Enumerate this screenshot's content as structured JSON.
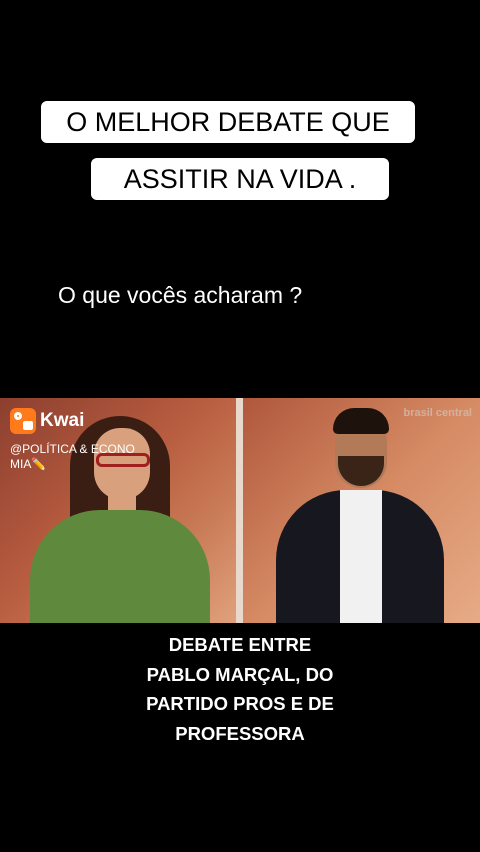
{
  "title": {
    "line1": "O MELHOR DEBATE QUE",
    "line2": "ASSITIR NA VIDA ."
  },
  "question": "O que vocês acharam ?",
  "video": {
    "watermark": {
      "brand": "Kwai",
      "handle_line1": "@POLÍTICA & ECONO",
      "handle_line2": "MIA✏️"
    },
    "station": "brasil central"
  },
  "caption": {
    "lines": [
      "DEBATE ENTRE",
      "PABLO MARÇAL, DO",
      "PARTIDO PROS E DE",
      "PROFESSORA"
    ]
  },
  "colors": {
    "background": "#000000",
    "title_bg": "#ffffff",
    "kwai_orange": "#ff7a1a"
  }
}
